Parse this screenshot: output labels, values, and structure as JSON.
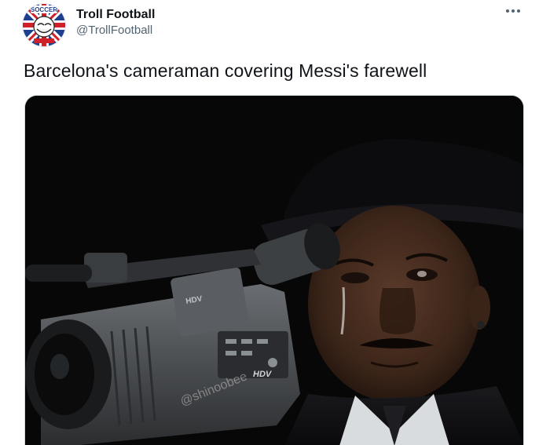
{
  "author": {
    "display_name": "Troll Football",
    "handle": "@TrollFootball",
    "avatar_text": "SOCCER",
    "avatar_icon": "troll-face-union-jack-logo"
  },
  "more_icon": "more-horizontal-icon",
  "tweet": {
    "text": "Barcelona's cameraman covering Messi's farewell"
  },
  "media": {
    "camera_brand_text": "HDV",
    "watermark_text": "@shinoobee"
  }
}
